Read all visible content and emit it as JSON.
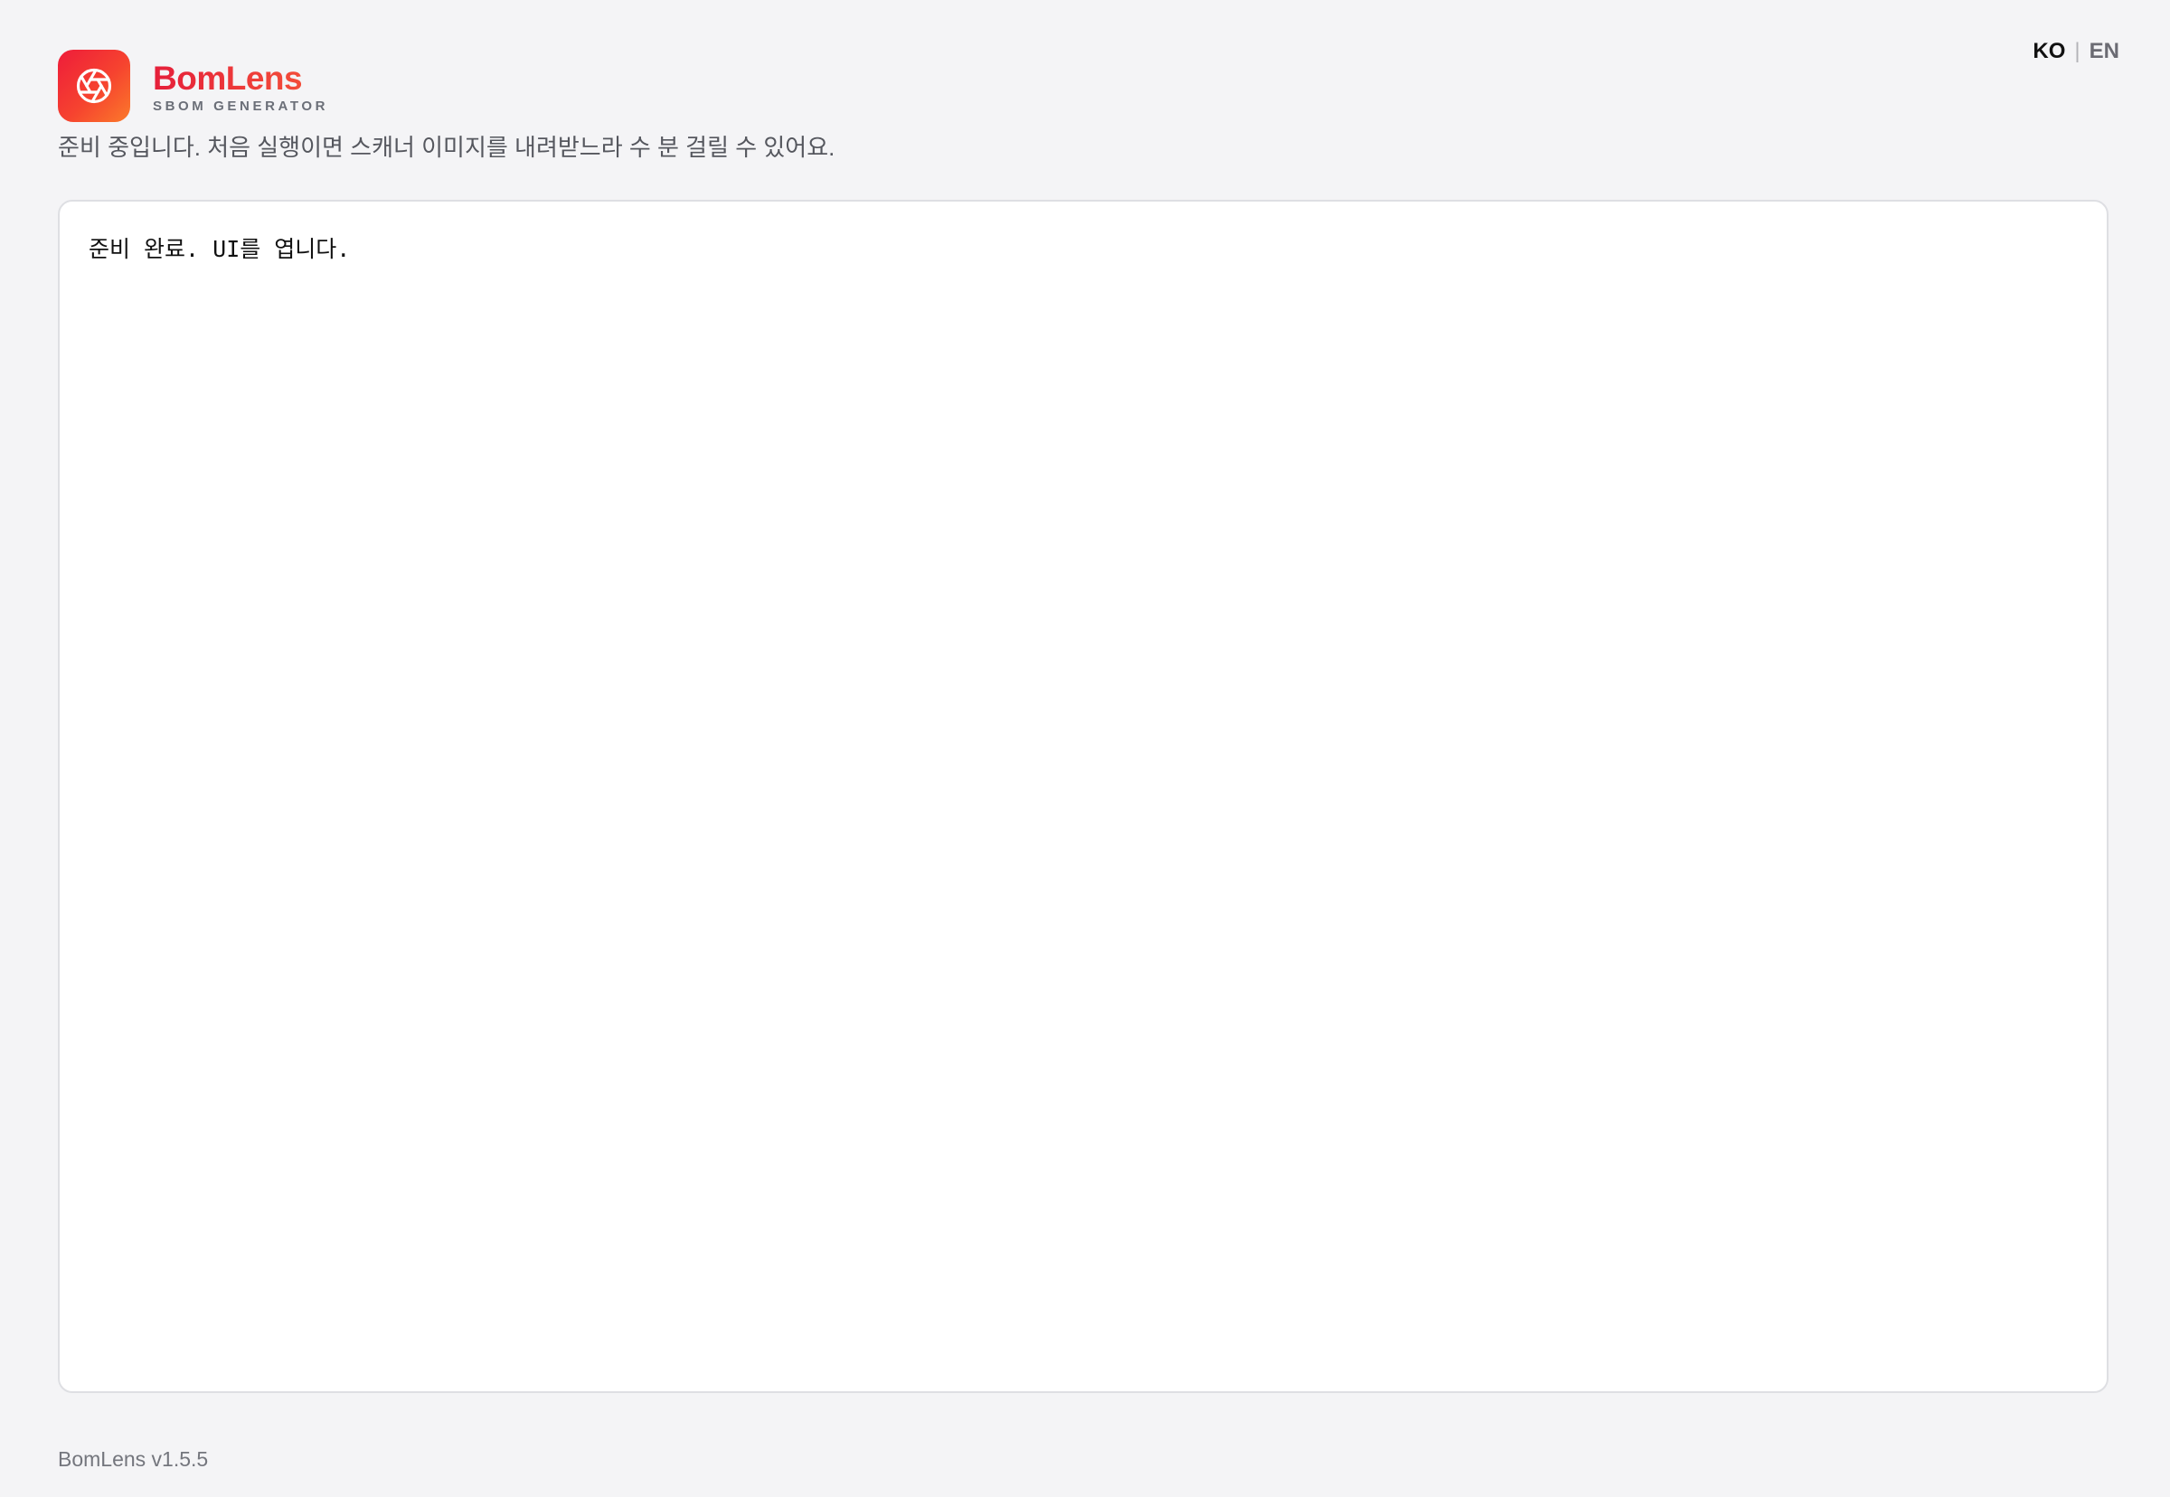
{
  "header": {
    "icon": "aperture-icon",
    "brand_name": "BomLens",
    "brand_subtitle": "SBOM GENERATOR",
    "brand_gradient": [
      "#ee1c3a",
      "#fb7a2a"
    ]
  },
  "language": {
    "active": "KO",
    "separator": "|",
    "inactive": "EN"
  },
  "status_message": "준비 중입니다. 처음 실행이면 스캐너 이미지를 내려받느라 수 분 걸릴 수 있어요.",
  "console": {
    "lines": [
      "준비 완료. UI를 엽니다."
    ]
  },
  "footer": {
    "version": "BomLens v1.5.5"
  }
}
